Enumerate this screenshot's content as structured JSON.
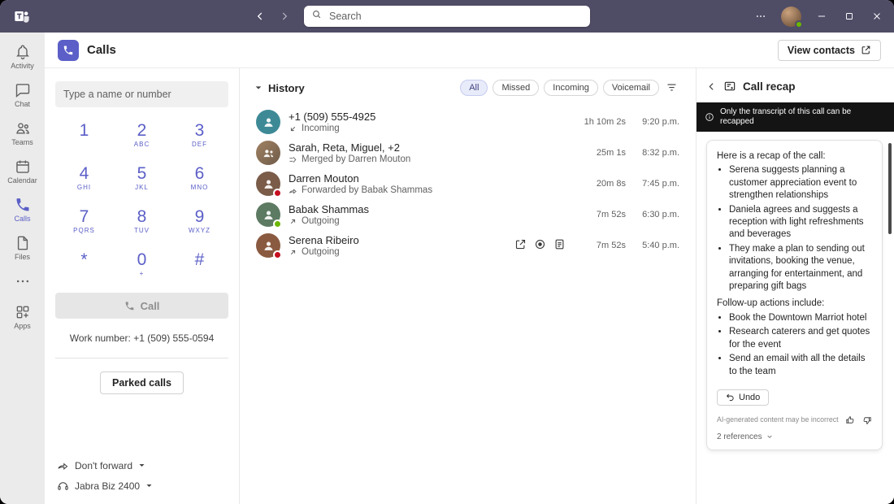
{
  "colors": {
    "accent": "#5b5fc7",
    "titlebar": "#4f4c66",
    "busy": "#c50f1f",
    "available": "#6bb700",
    "notice_bg": "#141414"
  },
  "titlebar": {
    "search_placeholder": "Search"
  },
  "rail": {
    "items": [
      {
        "label": "Activity"
      },
      {
        "label": "Chat"
      },
      {
        "label": "Teams"
      },
      {
        "label": "Calendar"
      },
      {
        "label": "Calls"
      },
      {
        "label": "Files"
      },
      {
        "label": ""
      },
      {
        "label": "Apps"
      }
    ]
  },
  "header": {
    "title": "Calls",
    "view_contacts": "View contacts"
  },
  "dialpad": {
    "input_placeholder": "Type a name or number",
    "keys": [
      {
        "d": "1",
        "l": ""
      },
      {
        "d": "2",
        "l": "ABC"
      },
      {
        "d": "3",
        "l": "DEF"
      },
      {
        "d": "4",
        "l": "GHI"
      },
      {
        "d": "5",
        "l": "JKL"
      },
      {
        "d": "6",
        "l": "MNO"
      },
      {
        "d": "7",
        "l": "PQRS"
      },
      {
        "d": "8",
        "l": "TUV"
      },
      {
        "d": "9",
        "l": "WXYZ"
      },
      {
        "d": "*",
        "l": ""
      },
      {
        "d": "0",
        "l": "+"
      },
      {
        "d": "#",
        "l": ""
      }
    ],
    "call_button": "Call",
    "work_number": "Work number: +1 (509) 555-0594",
    "parked_calls": "Parked calls",
    "forward_setting": "Don't forward",
    "device": "Jabra Biz 2400"
  },
  "history": {
    "title": "History",
    "filters": [
      "All",
      "Missed",
      "Incoming",
      "Voicemail"
    ],
    "calls": [
      {
        "name": "+1 (509) 555-4925",
        "detail": "Incoming",
        "duration": "1h 10m 2s",
        "time": "9:20 p.m."
      },
      {
        "name": "Sarah, Reta, Miguel, +2",
        "detail": "Merged by Darren Mouton",
        "duration": "25m 1s",
        "time": "8:32 p.m."
      },
      {
        "name": "Darren Mouton",
        "detail": "Forwarded by Babak Shammas",
        "duration": "20m 8s",
        "time": "7:45 p.m."
      },
      {
        "name": "Babak Shammas",
        "detail": "Outgoing",
        "duration": "7m 52s",
        "time": "6:30 p.m."
      },
      {
        "name": "Serena Ribeiro",
        "detail": "Outgoing",
        "duration": "7m 52s",
        "time": "5:40 p.m."
      }
    ]
  },
  "recap": {
    "title": "Call recap",
    "notice": "Only the transcript of this call can be recapped",
    "intro": "Here is a recap of the call:",
    "bullets1": [
      "Serena suggests planning a customer appreciation event to strengthen relationships",
      "Daniela agrees and suggests a reception with light refreshments and beverages",
      "They make a plan to sending out invitations, booking the venue, arranging for entertainment, and preparing gift bags"
    ],
    "followup_label": "Follow-up actions include:",
    "bullets2": [
      "Book the Downtown Marriot hotel",
      "Research caterers and get quotes for the event",
      "Send an email with all the details to the team"
    ],
    "undo": "Undo",
    "ai_note": "AI-generated content may be incorrect",
    "references": "2 references"
  }
}
